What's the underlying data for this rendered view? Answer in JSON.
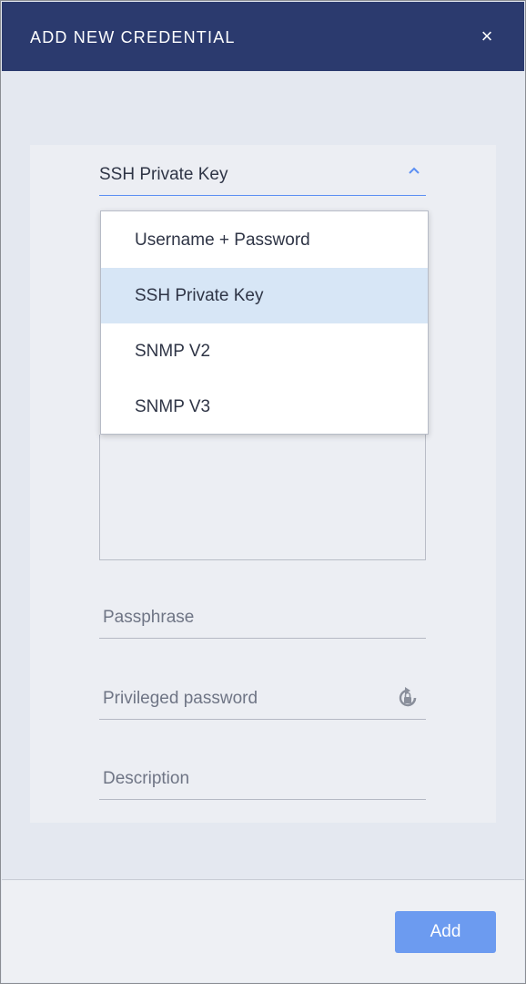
{
  "dialog": {
    "title": "ADD NEW CREDENTIAL",
    "close_symbol": "×"
  },
  "credential_type": {
    "selected": "SSH Private Key",
    "options": [
      "Username + Password",
      "SSH Private Key",
      "SNMP V2",
      "SNMP V3"
    ],
    "open": true
  },
  "fields": {
    "passphrase_placeholder": "Passphrase",
    "privileged_password_placeholder": "Privileged password",
    "description_placeholder": "Description"
  },
  "icons": {
    "close": "close-icon",
    "chevron": "chevron-up-icon",
    "password_generator": "lock-refresh-icon"
  },
  "footer": {
    "add_label": "Add"
  },
  "colors": {
    "header_bg": "#2b3a6e",
    "accent": "#5b8ff3",
    "button_bg": "#6c9bf0",
    "selected_option_bg": "#d7e6f6"
  }
}
